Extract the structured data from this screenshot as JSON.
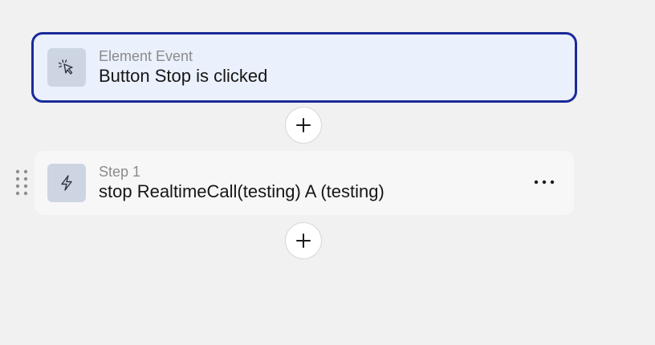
{
  "trigger": {
    "type_label": "Element Event",
    "title": "Button Stop is clicked",
    "icon": "cursor-click-icon"
  },
  "steps": [
    {
      "label": "Step 1",
      "title": "stop RealtimeCall(testing) A (testing)",
      "icon": "lightning-bolt-icon"
    }
  ],
  "add_buttons": [
    {
      "icon": "plus-icon"
    },
    {
      "icon": "plus-icon"
    }
  ],
  "colors": {
    "background": "#f1f1f1",
    "trigger_background": "#eaf0fc",
    "trigger_border": "#1a2a99",
    "icon_tile": "#cdd5e3",
    "step_background": "#f7f7f7"
  }
}
